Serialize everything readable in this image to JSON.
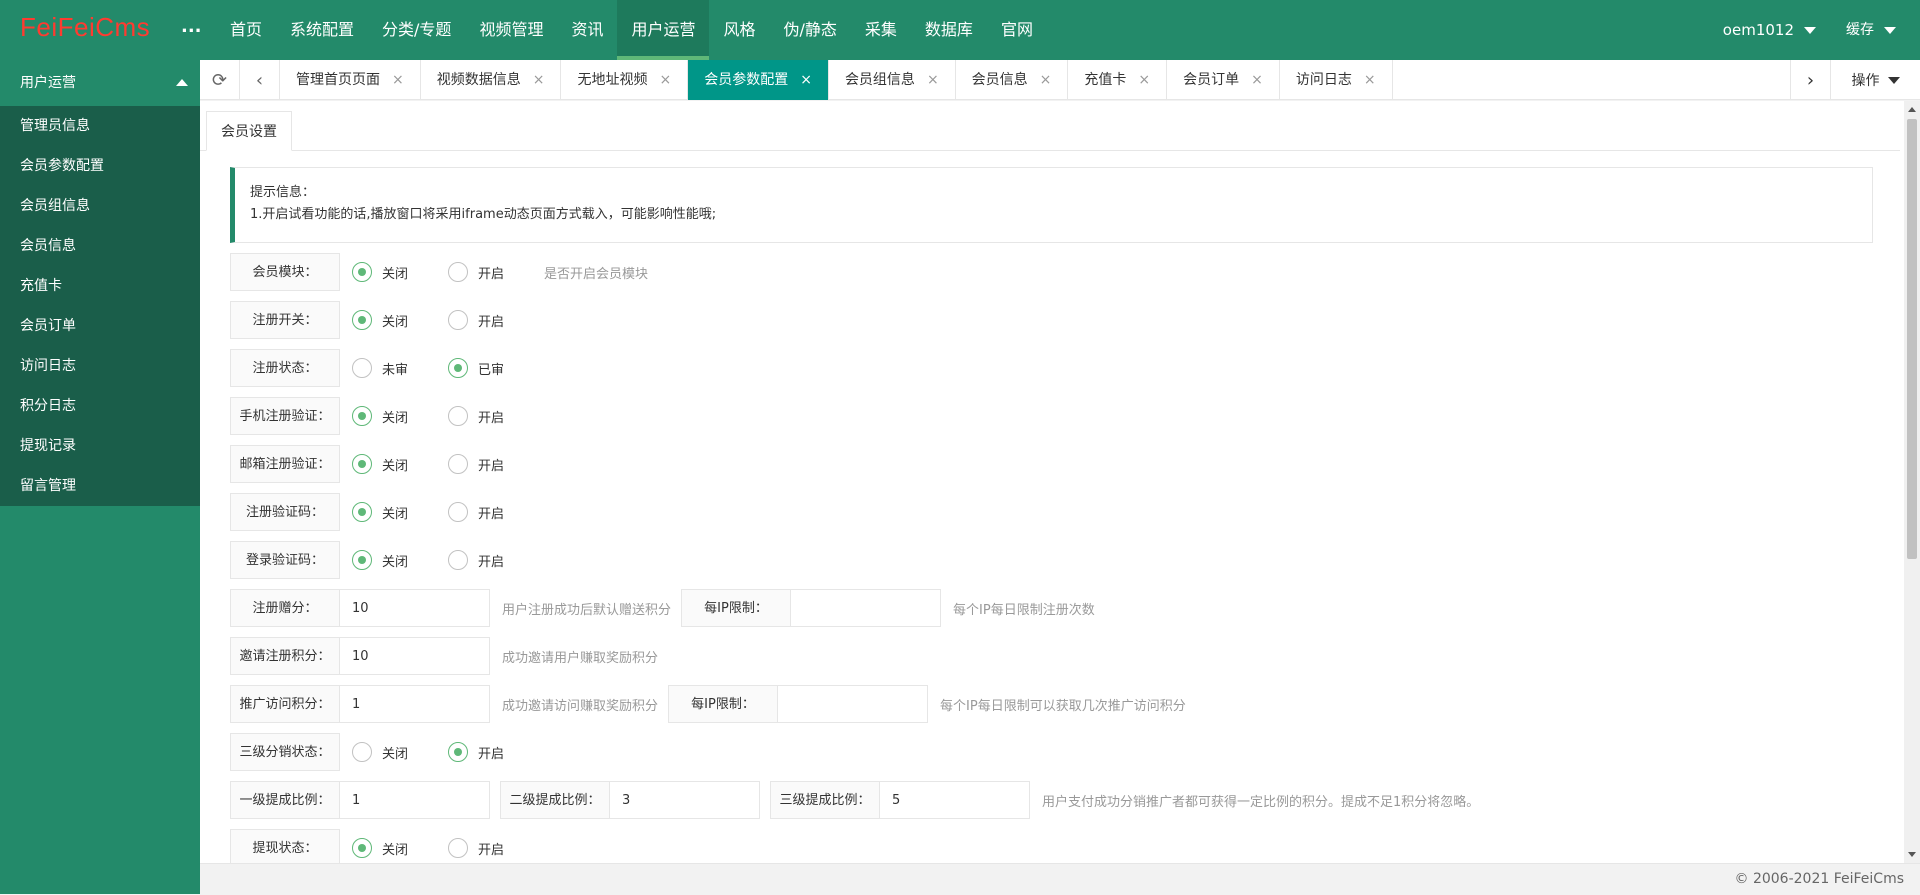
{
  "header": {
    "logo": "FeiFeiCms",
    "more": "...",
    "nav": [
      "首页",
      "系统配置",
      "分类/专题",
      "视频管理",
      "资讯",
      "用户运营",
      "风格",
      "伪/静态",
      "采集",
      "数据库",
      "官网"
    ],
    "active_nav": "用户运营",
    "user": "oem1012",
    "cache": "缓存"
  },
  "sidebar": {
    "title": "用户运营",
    "items": [
      "管理员信息",
      "会员参数配置",
      "会员组信息",
      "会员信息",
      "充值卡",
      "会员订单",
      "访问日志",
      "积分日志",
      "提现记录",
      "留言管理"
    ]
  },
  "tabs": {
    "items": [
      "管理首页页面",
      "视频数据信息",
      "无地址视频",
      "会员参数配置",
      "会员组信息",
      "会员信息",
      "充值卡",
      "会员订单",
      "访问日志"
    ],
    "active": "会员参数配置",
    "close": "×",
    "ops": "操作"
  },
  "content": {
    "subtab": "会员设置",
    "tip_title": "提示信息：",
    "tip_line": "1.开启试看功能的话,播放窗口将采用iframe动态页面方式载入，可能影响性能哦;",
    "rows": {
      "member_module": {
        "label": "会员模块：",
        "opt1": "关闭",
        "opt2": "开启",
        "selected": 1,
        "hint": "是否开启会员模块"
      },
      "register_switch": {
        "label": "注册开关：",
        "opt1": "关闭",
        "opt2": "开启",
        "selected": 1
      },
      "register_status": {
        "label": "注册状态：",
        "opt1": "未审",
        "opt2": "已审",
        "selected": 2
      },
      "phone_verify": {
        "label": "手机注册验证：",
        "opt1": "关闭",
        "opt2": "开启",
        "selected": 1
      },
      "email_verify": {
        "label": "邮箱注册验证：",
        "opt1": "关闭",
        "opt2": "开启",
        "selected": 1
      },
      "register_captcha": {
        "label": "注册验证码：",
        "opt1": "关闭",
        "opt2": "开启",
        "selected": 1
      },
      "login_captcha": {
        "label": "登录验证码：",
        "opt1": "关闭",
        "opt2": "开启",
        "selected": 1
      },
      "register_gift": {
        "label": "注册赠分：",
        "value": "10",
        "hint": "用户注册成功后默认赠送积分",
        "ip_label": "每IP限制：",
        "ip_value": "",
        "ip_hint": "每个IP每日限制注册次数"
      },
      "invite_points": {
        "label": "邀请注册积分：",
        "value": "10",
        "hint": "成功邀请用户赚取奖励积分"
      },
      "promo_points": {
        "label": "推广访问积分：",
        "value": "1",
        "hint": "成功邀请访问赚取奖励积分",
        "ip_label": "每IP限制：",
        "ip_value": "",
        "ip_hint": "每个IP每日限制可以获取几次推广访问积分"
      },
      "tier3_status": {
        "label": "三级分销状态：",
        "opt1": "关闭",
        "opt2": "开启",
        "selected": 2
      },
      "ratios": {
        "label1": "一级提成比例：",
        "value1": "1",
        "label2": "二级提成比例：",
        "value2": "3",
        "label3": "三级提成比例：",
        "value3": "5",
        "hint": "用户支付成功分销推广者都可获得一定比例的积分。提成不足1积分将忽略。"
      },
      "withdraw_status": {
        "label": "提现状态：",
        "opt1": "关闭",
        "opt2": "开启",
        "selected": 1
      }
    }
  },
  "footer": "© 2006-2021 FeiFeiCms"
}
